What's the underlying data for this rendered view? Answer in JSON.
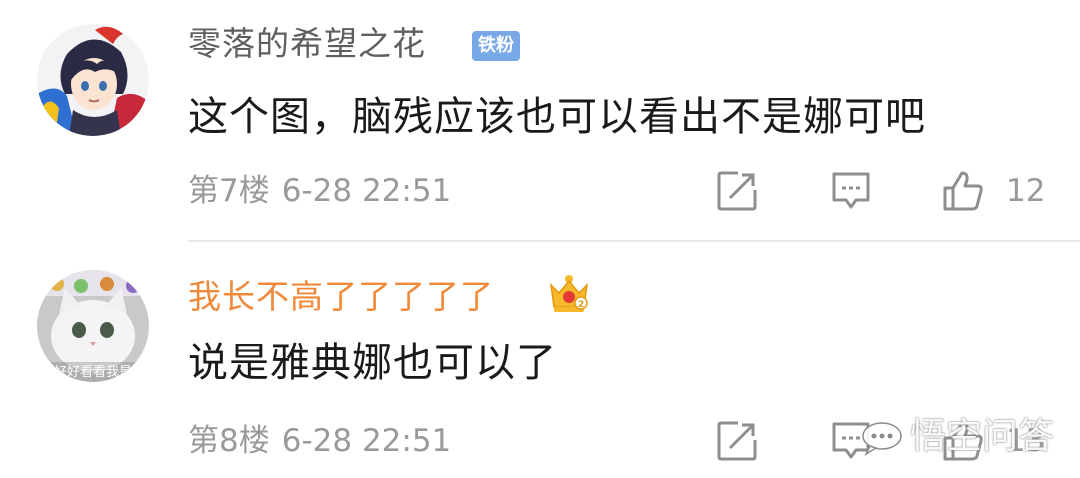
{
  "comments": [
    {
      "username": "零落的希望之花",
      "badge": "铁粉",
      "content": "这个图，脑残应该也可以看出不是娜可吧",
      "floor": "第7楼",
      "time": "6-28 22:51",
      "likes": "12",
      "avatar_icon": "anime-character-avatar"
    },
    {
      "username": "我长不高了了了了了",
      "badge_icon": "crown-icon",
      "content": "说是雅典娜也可以了",
      "floor": "第8楼",
      "time": "6-28 22:51",
      "likes": "13",
      "avatar_icon": "white-cat-avatar",
      "avatar_caption": "好好看看我是"
    }
  ],
  "actions": {
    "share_icon": "share-icon",
    "reply_icon": "comment-icon",
    "like_icon": "thumbs-up-icon"
  },
  "watermark": {
    "text": "悟空问答"
  },
  "colors": {
    "username_default": "#5f5f5f",
    "username_vip": "#f0893a",
    "badge_bg": "#79a8e6",
    "meta_gray": "#9a9a9a",
    "content_text": "#1a1a1a",
    "divider": "#e9e9e9"
  }
}
